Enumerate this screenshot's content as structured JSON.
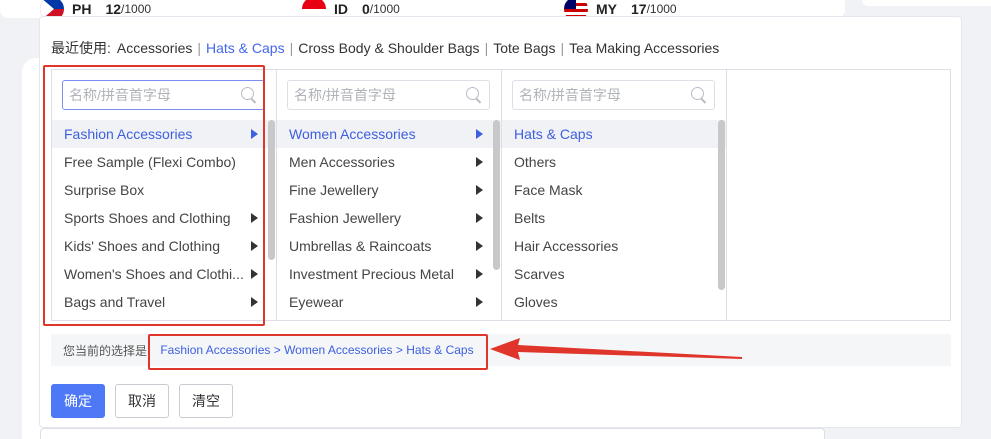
{
  "countries": [
    {
      "code": "PH",
      "count": "12",
      "total": "/1000"
    },
    {
      "code": "ID",
      "count": "0",
      "total": "/1000"
    },
    {
      "code": "MY",
      "count": "17",
      "total": "/1000"
    }
  ],
  "recent": {
    "label": "最近使用:",
    "items": [
      "Accessories",
      "Hats & Caps",
      "Cross Body & Shoulder Bags",
      "Tote Bags",
      "Tea Making Accessories"
    ],
    "separator": "|",
    "active_index": 1
  },
  "search_placeholder": "名称/拼音首字母",
  "columns": [
    {
      "items": [
        {
          "label": "Fashion Accessories",
          "has_children": true,
          "selected": true
        },
        {
          "label": "Free Sample (Flexi Combo)",
          "has_children": false
        },
        {
          "label": "Surprise Box",
          "has_children": false
        },
        {
          "label": "Sports Shoes and Clothing",
          "has_children": true
        },
        {
          "label": "Kids' Shoes and Clothing",
          "has_children": true
        },
        {
          "label": "Women's Shoes and Clothi...",
          "has_children": true
        },
        {
          "label": "Bags and Travel",
          "has_children": true
        }
      ]
    },
    {
      "items": [
        {
          "label": "Women Accessories",
          "has_children": true,
          "selected": true
        },
        {
          "label": "Men Accessories",
          "has_children": true
        },
        {
          "label": "Fine Jewellery",
          "has_children": true
        },
        {
          "label": "Fashion Jewellery",
          "has_children": true
        },
        {
          "label": "Umbrellas & Raincoats",
          "has_children": true
        },
        {
          "label": "Investment Precious Metal",
          "has_children": true
        },
        {
          "label": "Eyewear",
          "has_children": true
        }
      ]
    },
    {
      "items": [
        {
          "label": "Hats & Caps",
          "has_children": false,
          "selected": true
        },
        {
          "label": "Others",
          "has_children": false
        },
        {
          "label": "Face Mask",
          "has_children": false
        },
        {
          "label": "Belts",
          "has_children": false
        },
        {
          "label": "Hair Accessories",
          "has_children": false
        },
        {
          "label": "Scarves",
          "has_children": false
        },
        {
          "label": "Gloves",
          "has_children": false
        }
      ]
    }
  ],
  "current_selection": {
    "label": "您当前的选择是:",
    "path": "Fashion Accessories > Women Accessories > Hats & Caps"
  },
  "buttons": {
    "confirm": "确定",
    "cancel": "取消",
    "clear": "清空"
  },
  "colors": {
    "accent": "#4d79f6",
    "link": "#3d5fe0",
    "annotation": "#e0352b"
  }
}
